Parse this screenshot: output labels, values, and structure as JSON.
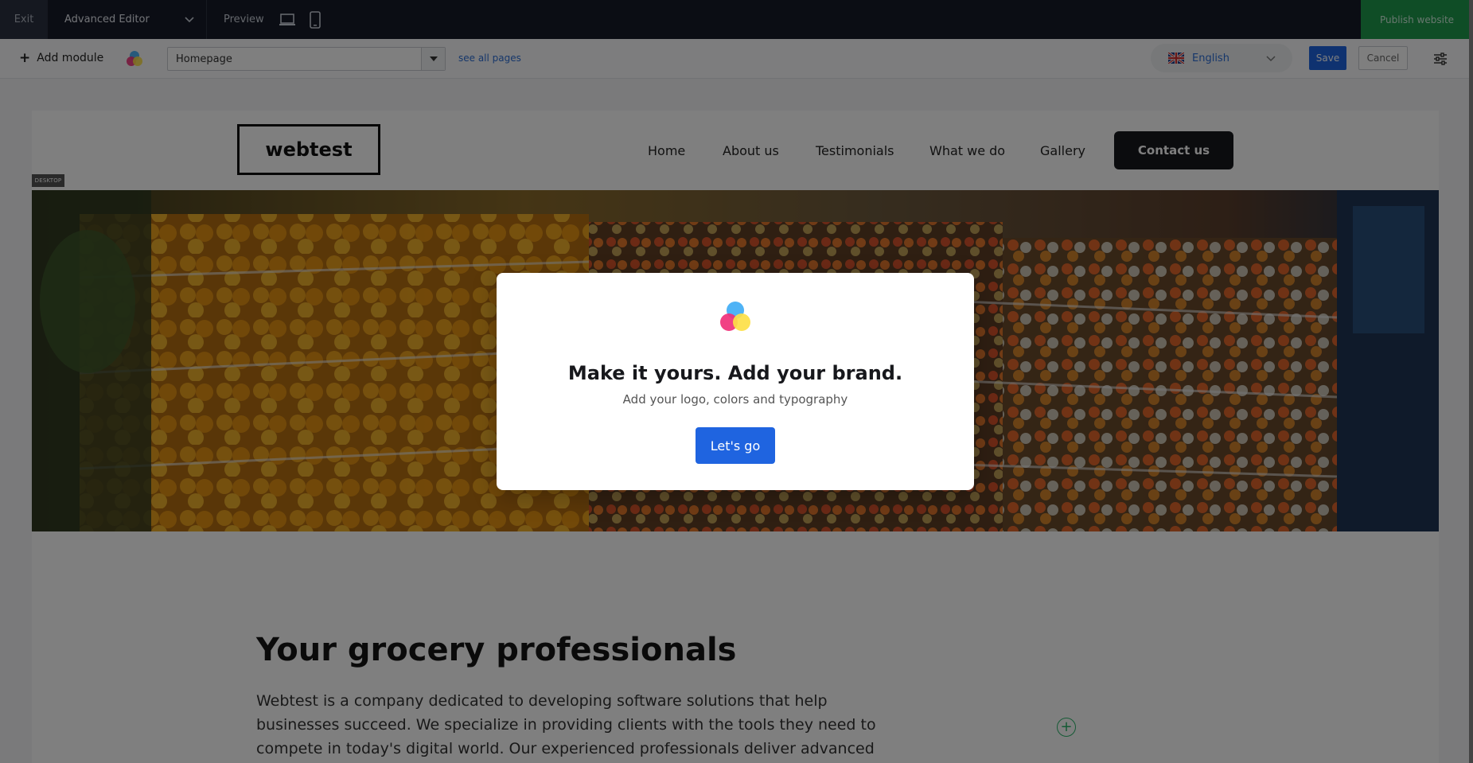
{
  "topbar": {
    "exit_label": "Exit",
    "mode_label": "Advanced Editor",
    "preview_label": "Preview",
    "publish_label": "Publish website"
  },
  "toolbar": {
    "add_module_label": "Add module",
    "page_select_value": "Homepage",
    "see_all_pages_label": "see all pages",
    "language_label": "English",
    "save_label": "Save",
    "cancel_label": "Cancel"
  },
  "site": {
    "logo_text": "webtest",
    "nav": [
      "Home",
      "About us",
      "Testimonials",
      "What we do",
      "Gallery"
    ],
    "contact_label": "Contact us",
    "device_tag": "DESKTOP"
  },
  "content": {
    "heading": "Your grocery professionals",
    "paragraph": "Webtest is a company dedicated to developing software solutions that help businesses succeed. We specialize in providing clients with the tools they need to compete in today's digital world. Our experienced professionals deliver advanced"
  },
  "modal": {
    "title": "Make it yours. Add your brand.",
    "subtitle": "Add your logo, colors and typography",
    "button_label": "Let's go"
  },
  "colors": {
    "topbar_bg": "#161b28",
    "publish_green": "#1e9b4c",
    "accent_blue": "#1f64e0",
    "brand_blue": "#4fb3f6",
    "brand_pink": "#f0317a",
    "brand_yellow": "#fde047"
  }
}
